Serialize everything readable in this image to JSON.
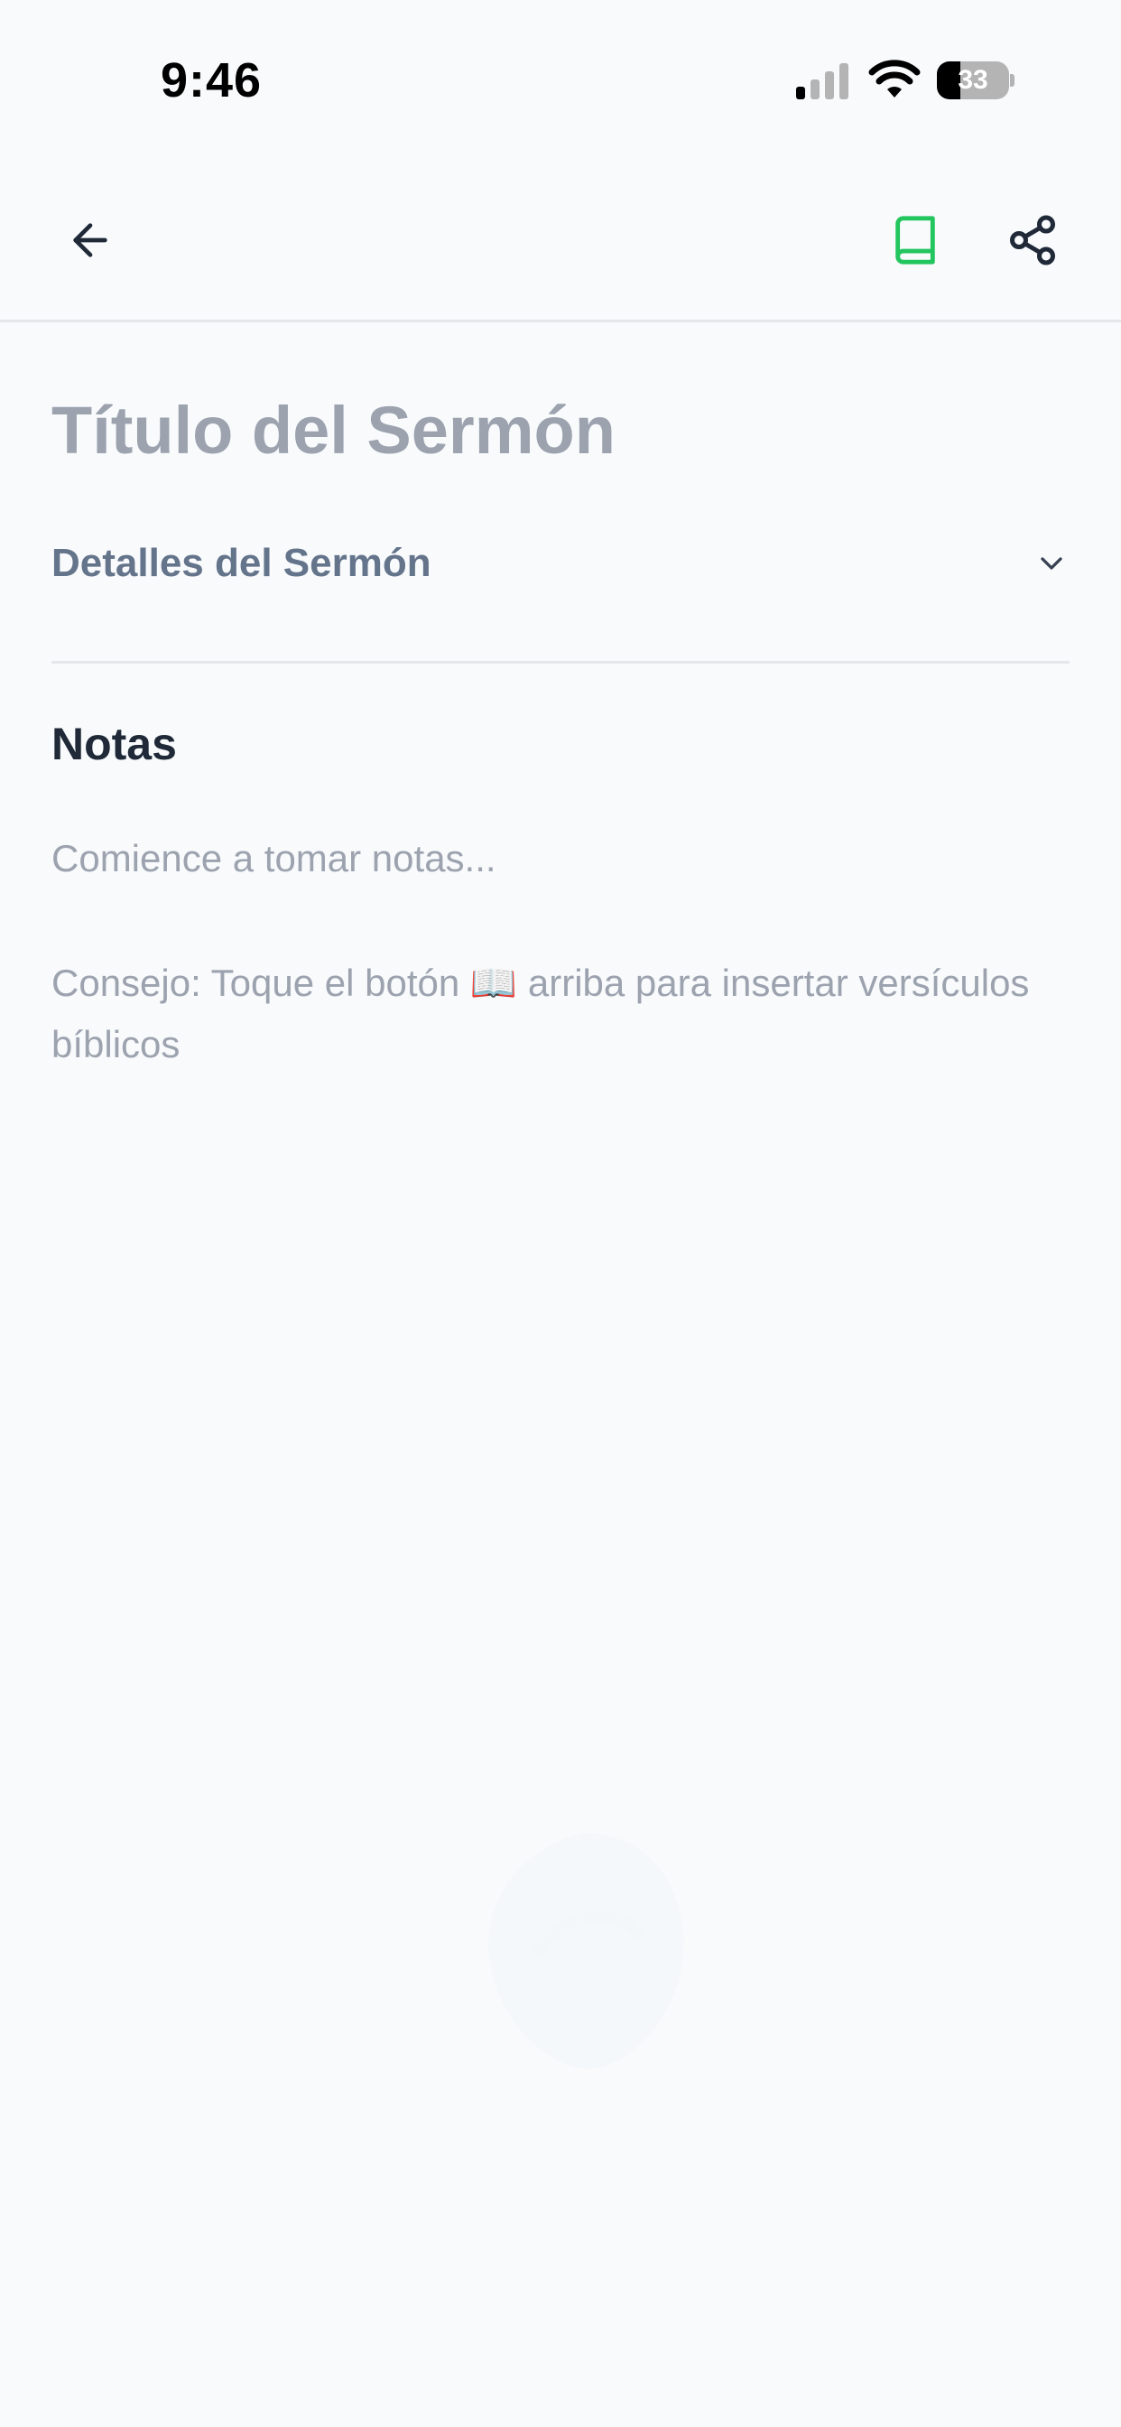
{
  "status_bar": {
    "time": "9:46",
    "battery": "33",
    "battery_level": 0.33,
    "icons": [
      "signal-icon",
      "wifi-icon",
      "battery-icon"
    ]
  },
  "header": {
    "back_icon": "arrow-left-icon",
    "bible_icon": "book-icon",
    "share_icon": "share-icon",
    "accent_color": "#22c55e"
  },
  "main": {
    "title": "Título del Sermón",
    "details_label": "Detalles del Sermón",
    "notes_heading": "Notas",
    "notes_placeholder": "Comience a tomar notas...",
    "tip": "Consejo: Toque el botón 📖 arriba para insertar versículos bíblicos"
  }
}
